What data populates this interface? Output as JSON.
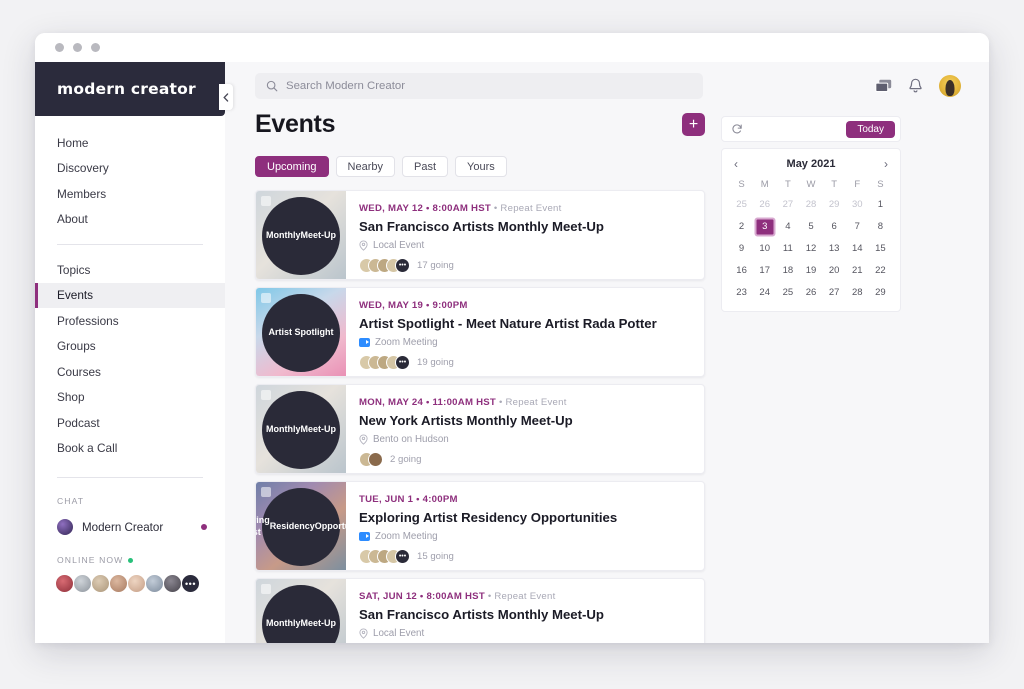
{
  "window": {
    "dots": 3
  },
  "sidebar": {
    "brand": "modern creator",
    "nav_primary": [
      {
        "label": "Home"
      },
      {
        "label": "Discovery"
      },
      {
        "label": "Members"
      },
      {
        "label": "About"
      }
    ],
    "nav_secondary": [
      {
        "label": "Topics",
        "active": false
      },
      {
        "label": "Events",
        "active": true
      },
      {
        "label": "Professions",
        "active": false
      },
      {
        "label": "Groups",
        "active": false
      },
      {
        "label": "Courses",
        "active": false
      },
      {
        "label": "Shop",
        "active": false
      },
      {
        "label": "Podcast",
        "active": false
      },
      {
        "label": "Book a Call",
        "active": false
      }
    ],
    "chat_label": "CHAT",
    "chat_item": "Modern Creator",
    "online_label": "ONLINE NOW",
    "online_avatars": [
      "#b5505a",
      "#9aa3ad",
      "#b9a893",
      "#c0a08e",
      "#d3b8a5",
      "#9fb0c1",
      "#6d6a72",
      "#2b2b3c"
    ],
    "online_more_label": "•••",
    "collapse_icon": "chevron-left-icon"
  },
  "topbar": {
    "search_placeholder": "Search Modern Creator",
    "icons": [
      "chat-icon",
      "bell-icon",
      "user-avatar"
    ]
  },
  "main": {
    "title": "Events",
    "add_button_label": "+",
    "tabs": [
      {
        "label": "Upcoming",
        "active": true
      },
      {
        "label": "Nearby",
        "active": false
      },
      {
        "label": "Past",
        "active": false
      },
      {
        "label": "Yours",
        "active": false
      }
    ],
    "events": [
      {
        "meta_date": "WED, MAY 12 • 8:00AM HST",
        "meta_repeat": " • Repeat Event",
        "title": "San Francisco Artists Monthly Meet-Up",
        "location": "Local Event",
        "location_type": "pin",
        "going": "17 going",
        "thumb_label": "Monthly\nMeet-Up",
        "thumb_bg": "linear-gradient(135deg,#cfd6dc 0%,#e6e2dc 45%,#b9c4cc 100%)",
        "avatars": [
          "#d8c9a8",
          "#cbb894",
          "#bda882",
          "#d5c6a5",
          "#2a2a38"
        ]
      },
      {
        "meta_date": "WED, MAY 19 • 9:00PM",
        "meta_repeat": "",
        "title": "Artist Spotlight - Meet Nature Artist Rada Potter",
        "location": "Zoom Meeting",
        "location_type": "zoom",
        "going": "19 going",
        "thumb_label": "Artist Spotlight",
        "thumb_bg": "linear-gradient(150deg,#7fc8e8 0%,#c8d8ea 35%,#f0b9cd 70%,#e98fb4 100%)",
        "avatars": [
          "#d8c9a8",
          "#cbb894",
          "#bda882",
          "#d5c6a5",
          "#2a2a38"
        ]
      },
      {
        "meta_date": "MON, MAY 24 • 11:00AM HST",
        "meta_repeat": " • Repeat Event",
        "title": "New York Artists Monthly Meet-Up",
        "location": "Bento on Hudson",
        "location_type": "pin",
        "going": "2 going",
        "thumb_label": "Monthly\nMeet-Up",
        "thumb_bg": "linear-gradient(135deg,#cfd6dc 0%,#e6e2dc 45%,#b9c4cc 100%)",
        "avatars": [
          "#cbb894",
          "#8a6a4c"
        ]
      },
      {
        "meta_date": "TUE, JUN 1 • 4:00PM",
        "meta_repeat": "",
        "title": "Exploring Artist Residency Opportunities",
        "location": "Zoom Meeting",
        "location_type": "zoom",
        "going": "15 going",
        "thumb_label": "Exploring Artist\nResidency\nOpportunities",
        "thumb_bg": "linear-gradient(140deg,#6f7fa8 0%,#a08ab0 30%,#c79a88 60%,#7a8fa0 100%)",
        "avatars": [
          "#d8c9a8",
          "#cbb894",
          "#bda882",
          "#d5c6a5",
          "#2a2a38"
        ]
      },
      {
        "meta_date": "SAT, JUN 12 • 8:00AM HST",
        "meta_repeat": " • Repeat Event",
        "title": "San Francisco Artists Monthly Meet-Up",
        "location": "Local Event",
        "location_type": "pin",
        "going": "",
        "thumb_label": "Monthly\nMeet-Up",
        "thumb_bg": "linear-gradient(135deg,#cfd6dc 0%,#e6e2dc 45%,#b9c4cc 100%)",
        "avatars": []
      }
    ]
  },
  "calendar": {
    "refresh_icon": "refresh-icon",
    "today_label": "Today",
    "month_label": "May 2021",
    "prev_icon": "chevron-left-icon",
    "next_icon": "chevron-right-icon",
    "dow": [
      "S",
      "M",
      "T",
      "W",
      "T",
      "F",
      "S"
    ],
    "days": [
      {
        "n": "25",
        "muted": true
      },
      {
        "n": "26",
        "muted": true
      },
      {
        "n": "27",
        "muted": true
      },
      {
        "n": "28",
        "muted": true
      },
      {
        "n": "29",
        "muted": true
      },
      {
        "n": "30",
        "muted": true
      },
      {
        "n": "1",
        "muted": false
      },
      {
        "n": "2"
      },
      {
        "n": "3",
        "selected": true
      },
      {
        "n": "4"
      },
      {
        "n": "5"
      },
      {
        "n": "6"
      },
      {
        "n": "7"
      },
      {
        "n": "8"
      },
      {
        "n": "9"
      },
      {
        "n": "10"
      },
      {
        "n": "11"
      },
      {
        "n": "12"
      },
      {
        "n": "13"
      },
      {
        "n": "14"
      },
      {
        "n": "15"
      },
      {
        "n": "16"
      },
      {
        "n": "17"
      },
      {
        "n": "18"
      },
      {
        "n": "19"
      },
      {
        "n": "20"
      },
      {
        "n": "21"
      },
      {
        "n": "22"
      },
      {
        "n": "23"
      },
      {
        "n": "24"
      },
      {
        "n": "25"
      },
      {
        "n": "26"
      },
      {
        "n": "27"
      },
      {
        "n": "28"
      },
      {
        "n": "29"
      }
    ]
  },
  "colors": {
    "accent": "#8e2f7d",
    "brand_bg": "#2b2b3c",
    "online": "#28c07a",
    "zoom": "#2d8cff"
  }
}
